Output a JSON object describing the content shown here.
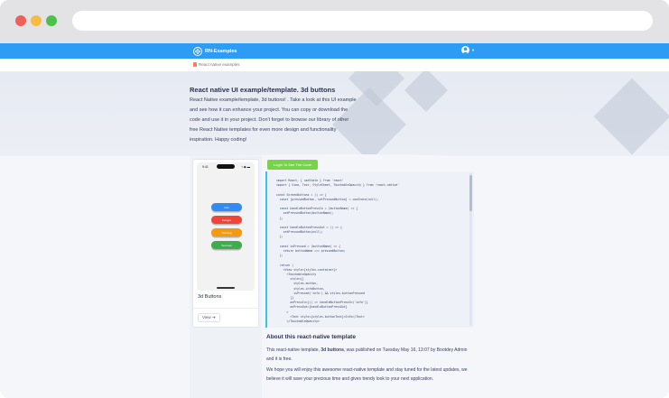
{
  "app": {
    "brand_name": "RN-Examples"
  },
  "breadcrumb": {
    "label": "React native examples"
  },
  "hero": {
    "title": "React native UI example/template. 3d buttons",
    "description": "React Native example/template, 3d buttons! . Take a look at this UI example and see how it can enhance your project. You can copy or download the code and use it in your project. Don't forget to browse our library of other free React Native templates for even more design and functionality inspiration. Happy coding!"
  },
  "preview": {
    "status_time": "9:41",
    "status_icons": "▪ ◆ ▬",
    "buttons": [
      {
        "label": "Info",
        "color": "#2f8cf3"
      },
      {
        "label": "Danger",
        "color": "#f04438"
      },
      {
        "label": "Warning",
        "color": "#f59a0c"
      },
      {
        "label": "Success",
        "color": "#3dae4a"
      }
    ],
    "card_title": "3d Buttons",
    "view_label": "View",
    "view_arrow": "➔"
  },
  "actions": {
    "login_label": "Login To See The Code"
  },
  "code_lines": [
    "import React, { useState } from 'react'",
    "import { View, Text, StyleSheet, TouchableOpacity } from 'react-native'",
    "",
    "const ScreenButtons = () => {",
    "  const [pressedButton, setPressedButton] = useState(null);",
    "",
    "  const handleButtonPressIn = (buttonName) => {",
    "    setPressedButton(buttonName);",
    "  };",
    "",
    "  const handleButtonPressOut = () => {",
    "    setPressedButton(null);",
    "  };",
    "",
    "  const isPressed = (buttonName) => {",
    "    return buttonName === pressedButton;",
    "  };",
    "",
    "  return (",
    "    <View style={styles.container}>",
    "      <TouchableOpacity",
    "        style={[",
    "          styles.button,",
    "          styles.infoButton,",
    "          isPressed('info') && styles.buttonPressed",
    "        ]}",
    "        onPressIn={() => handleButtonPressIn('info')}",
    "        onPressOut={handleButtonPressOut}",
    "      >",
    "        <Text style={styles.buttonText}>Info</Text>",
    "      </TouchableOpacity>",
    "",
    "      <TouchableOpacity"
  ],
  "about": {
    "title": "About this react-native template",
    "p1_prefix": "This react-native template, ",
    "p1_name": "3d buttons",
    "p1_suffix": ", was published on Tuesday May 16, 13:07 by Bootdey Admin and it is free.",
    "p2": "We hope you will enjoy this awesome react-native template and stay tuned for the latest updates, we believe it will save your precious time and gives trendy look to your next application."
  },
  "colors": {
    "nav": "#2e9bf4",
    "login": "#77d34a",
    "code_accent": "#3cc2e8"
  },
  "icons": {
    "logo": "rn-logo-icon",
    "avatar": "user-avatar-icon",
    "breadcrumb": "book-icon"
  }
}
